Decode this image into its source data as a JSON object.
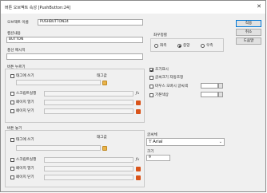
{
  "window": {
    "title": "버튼 오브젝트 속성 [PushButton:24]",
    "close_glyph": "✕"
  },
  "object_name": {
    "label": "오브젝트 이름",
    "value": "PUSHBUTTON24"
  },
  "caption": {
    "label": "캡션내용",
    "value": "BUTTON"
  },
  "tooltip": {
    "label": "풍선 메시지",
    "value": ""
  },
  "align": {
    "label": "좌우정렬",
    "options": [
      "좌측",
      "중앙",
      "우측"
    ],
    "selected": "중앙"
  },
  "press": {
    "label": "버튼 누르기",
    "tag_label": "태그값",
    "rows": [
      {
        "label": "태그에 쓰기",
        "checked": false,
        "icon": "folder-icon"
      },
      {
        "label": "스크립트실행",
        "checked": false,
        "icon": "fx-icon",
        "icon_text": "fx"
      },
      {
        "label": "페이지 열기",
        "checked": false,
        "icon": "page-icon"
      },
      {
        "label": "페이지 닫기",
        "checked": false,
        "icon": "page-icon"
      }
    ]
  },
  "release": {
    "label": "버튼 놓기",
    "tag_label": "태그값",
    "rows": [
      {
        "label": "태그에 쓰기",
        "checked": false,
        "icon": "folder-icon"
      },
      {
        "label": "스크립트실행",
        "checked": false,
        "icon": "fx-icon",
        "icon_text": "fx"
      },
      {
        "label": "페이지 열기",
        "checked": false,
        "icon": "page-icon"
      },
      {
        "label": "페이지 닫기",
        "checked": false,
        "icon": "page-icon"
      }
    ]
  },
  "options": [
    {
      "label": "초기표시",
      "checked": true
    },
    {
      "label": "글씨크기 자동조정",
      "checked": false
    },
    {
      "label": "마우스 오버시 글씨색",
      "checked": false
    },
    {
      "label": "기본색상",
      "checked": false
    }
  ],
  "font": {
    "label": "글씨체",
    "value": "Arial",
    "glyph": "Ŧ"
  },
  "size": {
    "label": "크기",
    "value": "9"
  },
  "buttons": {
    "ok": "적용",
    "cancel": "취소",
    "help": "도움말"
  },
  "colors": {
    "accent": "#0078d7",
    "folder": "#e8b34a",
    "page_icon": "#d9541a"
  }
}
